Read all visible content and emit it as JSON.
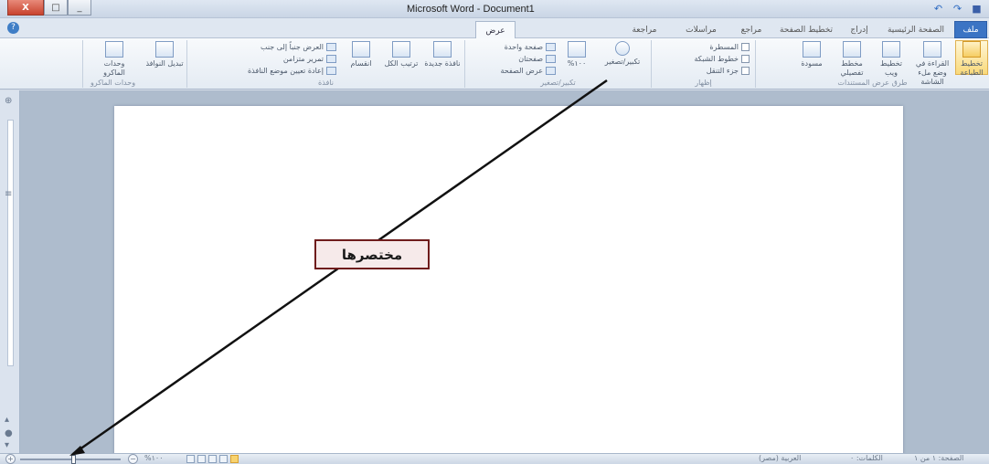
{
  "window": {
    "title": "Microsoft Word - Document1",
    "close": "X",
    "maximize": "□",
    "minimize": "_"
  },
  "qat": {
    "undo": "↶",
    "redo": "↷",
    "save": "■"
  },
  "tabs": [
    {
      "label": "ملف",
      "active": false,
      "file": true
    },
    {
      "label": "الصفحة الرئيسية",
      "active": false
    },
    {
      "label": "إدراج",
      "active": false
    },
    {
      "label": "تخطيط الصفحة",
      "active": false
    },
    {
      "label": "مراجع",
      "active": false
    },
    {
      "label": "مراسلات",
      "active": false
    },
    {
      "label": "مراجعة",
      "active": false
    },
    {
      "label": "عرض",
      "active": true
    }
  ],
  "ribbon": {
    "doc_views": {
      "group": "طرق عرض المستندات",
      "print_layout": "تخطيط الطباعة",
      "full_reading": "القراءة في وضع ملء الشاشة",
      "web_layout": "تخطيط ويب",
      "outline": "مخطط تفصيلي",
      "draft": "مسودة"
    },
    "show": {
      "group": "إظهار",
      "ruler": "المسطرة",
      "gridlines": "خطوط الشبكة",
      "nav_pane": "جزء التنقل"
    },
    "zoom": {
      "group": "تكبير/تصغير",
      "zoom": "تكبير/تصغير",
      "percent": "%١٠٠",
      "one_page": "صفحة واحدة",
      "two_pages": "صفحتان",
      "page_width": "عرض الصفحة"
    },
    "window": {
      "group": "نافذة",
      "new_window": "نافذة جديدة",
      "arrange_all": "ترتيب الكل",
      "split": "انقسام",
      "side_by_side": "العرض جنباً إلى جنب",
      "sync_scroll": "تمرير متزامن",
      "reset_pos": "إعادة تعيين موضع النافذة",
      "switch_windows": "تبديل النوافذ"
    },
    "macros": {
      "group": "وحدات الماكرو",
      "macros": "وحدات الماكرو"
    }
  },
  "callout": {
    "text": "مختصرها"
  },
  "statusbar": {
    "zoom_percent": "%١٠٠",
    "plus": "+",
    "minus": "−",
    "page": "الصفحة: ١ من ١",
    "words": "الكلمات: ٠",
    "language": "العربية (مصر)"
  }
}
